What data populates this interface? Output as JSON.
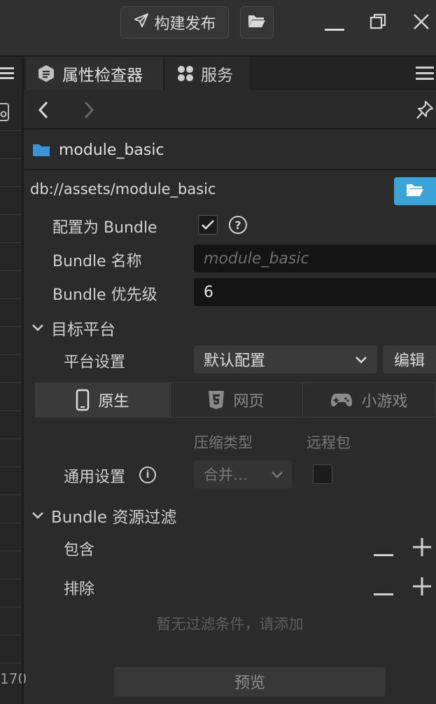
{
  "titlebar": {
    "build_label": "构建发布",
    "colors": {
      "bg": "#303030"
    }
  },
  "tabs": [
    {
      "label": "属性检查器",
      "icon": "inspector-icon",
      "active": true
    },
    {
      "label": "服务",
      "icon": "services-icon",
      "active": false
    }
  ],
  "asset": {
    "name": "module_basic",
    "path": "db://assets/module_basic"
  },
  "bundle": {
    "config_label": "配置为 Bundle",
    "config_checked": true,
    "name_label": "Bundle 名称",
    "name_placeholder": "module_basic",
    "priority_label": "Bundle 优先级",
    "priority_value": "6"
  },
  "target_platform": {
    "section_label": "目标平台",
    "platform_settings_label": "平台设置",
    "platform_select_value": "默认配置",
    "edit_label": "编辑",
    "platform_tabs": [
      {
        "label": "原生",
        "icon": "mobile-icon",
        "active": true
      },
      {
        "label": "网页",
        "icon": "html5-icon",
        "active": false
      },
      {
        "label": "小游戏",
        "icon": "gamepad-icon",
        "active": false
      }
    ],
    "col_compress": "压缩类型",
    "col_remote": "远程包",
    "general_label": "通用设置",
    "compress_value": "合并…",
    "remote_checked": false
  },
  "filter": {
    "section_label": "Bundle 资源过滤",
    "include_label": "包含",
    "exclude_label": "排除",
    "empty_text": "暂无过滤条件，请添加"
  },
  "preview_label": "预览",
  "left_panel": {
    "bottom_number": "170"
  },
  "colors": {
    "accent": "#3aa3d8",
    "folder": "#3a95d6"
  }
}
